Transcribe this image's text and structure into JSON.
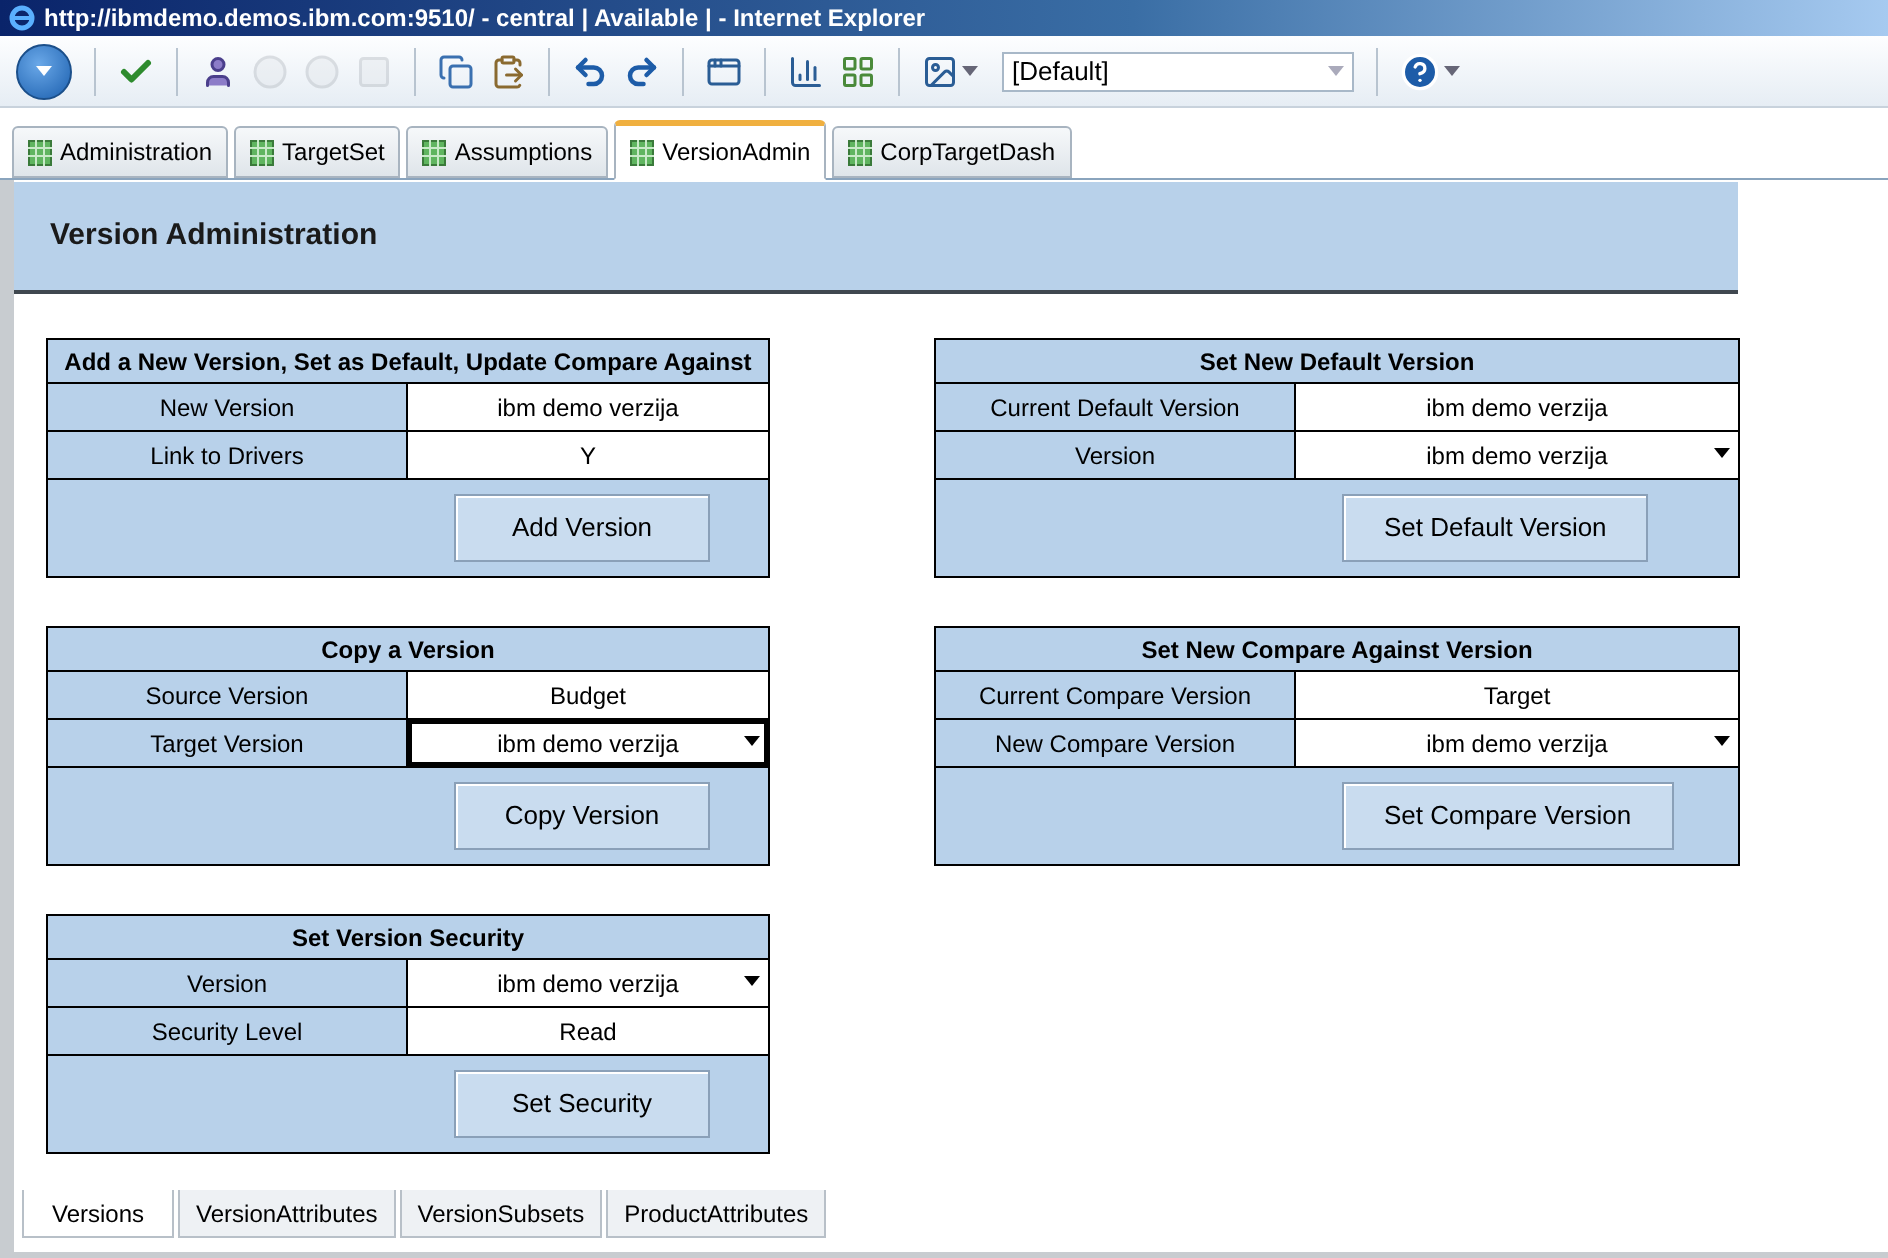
{
  "window": {
    "title": "http://ibmdemo.demos.ibm.com:9510/ - central | Available | - Internet Explorer"
  },
  "toolbar_groups": [
    [
      {
        "kind": "menu",
        "disabled": false
      }
    ],
    [
      {
        "kind": "check",
        "disabled": false
      }
    ],
    [
      {
        "kind": "user",
        "disabled": false
      },
      {
        "kind": "circle",
        "disabled": true
      },
      {
        "kind": "circle",
        "disabled": true
      },
      {
        "kind": "square",
        "disabled": true
      }
    ],
    [
      {
        "kind": "copy",
        "disabled": false
      },
      {
        "kind": "paste",
        "disabled": false
      }
    ],
    [
      {
        "kind": "undo",
        "disabled": false
      },
      {
        "kind": "redo",
        "disabled": false
      }
    ],
    [
      {
        "kind": "window",
        "disabled": false
      }
    ],
    [
      {
        "kind": "chart",
        "disabled": false
      },
      {
        "kind": "grid",
        "disabled": false
      }
    ],
    [
      {
        "kind": "image",
        "disabled": false
      },
      {
        "kind": "select",
        "disabled": false
      }
    ],
    [
      {
        "kind": "help",
        "disabled": false
      }
    ]
  ],
  "view_select": {
    "value": "[Default]"
  },
  "tabs": [
    {
      "label": "Administration",
      "selected": false
    },
    {
      "label": "TargetSet",
      "selected": false
    },
    {
      "label": "Assumptions",
      "selected": false
    },
    {
      "label": "VersionAdmin",
      "selected": true
    },
    {
      "label": "CorpTargetDash",
      "selected": false
    }
  ],
  "header": {
    "title": "Version Administration"
  },
  "panels": [
    {
      "title": "Add a New Version, Set as Default, Update Compare Against",
      "rows": [
        {
          "label": "New Version",
          "value": "ibm demo verzija",
          "dropdown": false,
          "selected": false
        },
        {
          "label": "Link to Drivers",
          "value": "Y",
          "dropdown": false,
          "selected": false
        }
      ],
      "button": "Add Version"
    },
    {
      "title": "Set New Default Version",
      "rows": [
        {
          "label": "Current Default Version",
          "value": "ibm demo verzija",
          "dropdown": false,
          "selected": false
        },
        {
          "label": "Version",
          "value": "ibm demo verzija",
          "dropdown": true,
          "selected": false
        }
      ],
      "button": "Set Default Version"
    },
    {
      "title": "Copy a Version",
      "rows": [
        {
          "label": "Source Version",
          "value": "Budget",
          "dropdown": false,
          "selected": false
        },
        {
          "label": "Target Version",
          "value": "ibm demo verzija",
          "dropdown": true,
          "selected": true
        }
      ],
      "button": "Copy Version"
    },
    {
      "title": "Set New Compare Against Version",
      "rows": [
        {
          "label": "Current Compare Version",
          "value": "Target",
          "dropdown": false,
          "selected": false
        },
        {
          "label": "New Compare Version",
          "value": "ibm demo verzija",
          "dropdown": true,
          "selected": false
        }
      ],
      "button": "Set Compare Version"
    },
    {
      "title": "Set Version Security",
      "rows": [
        {
          "label": "Version",
          "value": "ibm demo verzija",
          "dropdown": true,
          "selected": false
        },
        {
          "label": "Security Level",
          "value": "Read",
          "dropdown": false,
          "selected": false
        }
      ],
      "button": "Set Security"
    }
  ],
  "sheet_tabs": [
    {
      "label": "Versions",
      "selected": true
    },
    {
      "label": "VersionAttributes",
      "selected": false
    },
    {
      "label": "VersionSubsets",
      "selected": false
    },
    {
      "label": "ProductAttributes",
      "selected": false
    }
  ]
}
